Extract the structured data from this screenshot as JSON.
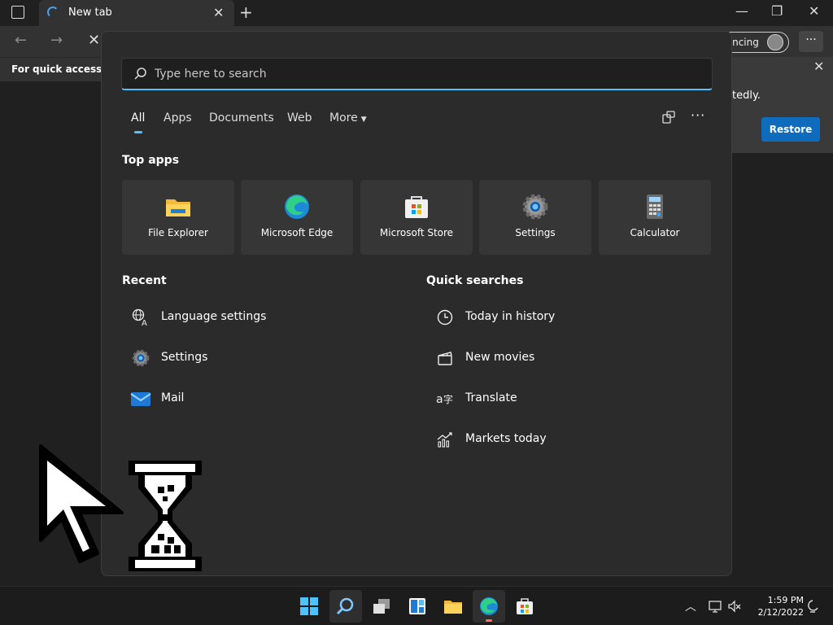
{
  "browser": {
    "tab_title": "New tab",
    "favbar_text": "For quick access, pla",
    "profile_label": "yncing",
    "menu_label": "···",
    "restore_message": "tedly.",
    "restore_button": "Restore"
  },
  "search": {
    "placeholder": "Type here to search",
    "filters": [
      {
        "label": "All",
        "active": true
      },
      {
        "label": "Apps",
        "active": false
      },
      {
        "label": "Documents",
        "active": false
      },
      {
        "label": "Web",
        "active": false
      },
      {
        "label": "More",
        "active": false
      }
    ],
    "more_menu_label": "···"
  },
  "top_apps": {
    "title": "Top apps",
    "items": [
      {
        "name": "File Explorer",
        "icon": "folder-icon"
      },
      {
        "name": "Microsoft Edge",
        "icon": "edge-icon"
      },
      {
        "name": "Microsoft Store",
        "icon": "store-icon"
      },
      {
        "name": "Settings",
        "icon": "gear-icon"
      },
      {
        "name": "Calculator",
        "icon": "calculator-icon"
      }
    ]
  },
  "recent": {
    "title": "Recent",
    "items": [
      {
        "label": "Language settings",
        "icon": "language-icon"
      },
      {
        "label": "Settings",
        "icon": "gear-icon"
      },
      {
        "label": "Mail",
        "icon": "mail-icon"
      }
    ]
  },
  "quick_searches": {
    "title": "Quick searches",
    "items": [
      {
        "label": "Today in history",
        "icon": "clock-icon"
      },
      {
        "label": "New movies",
        "icon": "clapperboard-icon"
      },
      {
        "label": "Translate",
        "icon": "translate-icon"
      },
      {
        "label": "Markets today",
        "icon": "chart-icon"
      }
    ]
  },
  "taskbar": {
    "time": "1:59 PM",
    "date": "2/12/2022",
    "colors": {
      "accent": "#4cc2ff",
      "restore_button": "#0f6cbd"
    }
  }
}
